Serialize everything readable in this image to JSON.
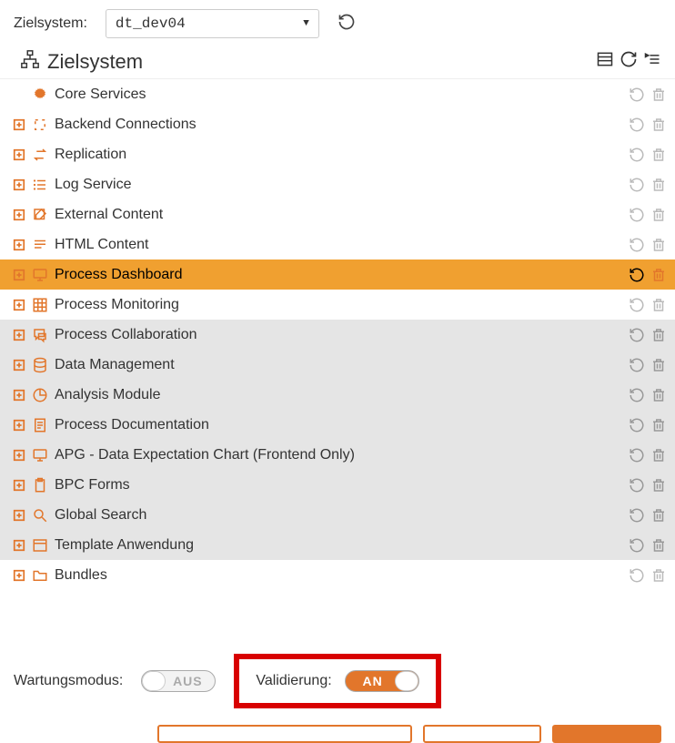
{
  "top": {
    "label": "Zielsystem:",
    "selected": "dt_dev04"
  },
  "section": {
    "title": "Zielsystem"
  },
  "tree": [
    {
      "label": "Core Services",
      "icon": "gear",
      "expand": false,
      "indent": true,
      "variant": "white",
      "selected": false
    },
    {
      "label": "Backend Connections",
      "icon": "brackets",
      "expand": true,
      "indent": false,
      "variant": "white",
      "selected": false
    },
    {
      "label": "Replication",
      "icon": "swap",
      "expand": true,
      "indent": false,
      "variant": "white",
      "selected": false
    },
    {
      "label": "Log Service",
      "icon": "list",
      "expand": true,
      "indent": false,
      "variant": "white",
      "selected": false
    },
    {
      "label": "External Content",
      "icon": "edit",
      "expand": true,
      "indent": false,
      "variant": "white",
      "selected": false
    },
    {
      "label": "HTML Content",
      "icon": "lines",
      "expand": true,
      "indent": false,
      "variant": "white",
      "selected": false
    },
    {
      "label": "Process Dashboard",
      "icon": "monitor",
      "expand": true,
      "indent": false,
      "variant": "sel",
      "selected": true
    },
    {
      "label": "Process Monitoring",
      "icon": "grid",
      "expand": true,
      "indent": false,
      "variant": "white",
      "selected": false
    },
    {
      "label": "Process Collaboration",
      "icon": "chat",
      "expand": true,
      "indent": false,
      "variant": "grey",
      "selected": false
    },
    {
      "label": "Data Management",
      "icon": "db",
      "expand": true,
      "indent": false,
      "variant": "grey",
      "selected": false
    },
    {
      "label": "Analysis Module",
      "icon": "pie",
      "expand": true,
      "indent": false,
      "variant": "grey",
      "selected": false
    },
    {
      "label": "Process Documentation",
      "icon": "doc",
      "expand": true,
      "indent": false,
      "variant": "grey",
      "selected": false
    },
    {
      "label": "APG - Data Expectation Chart (Frontend Only)",
      "icon": "monitor",
      "expand": true,
      "indent": false,
      "variant": "grey",
      "selected": false
    },
    {
      "label": "BPC Forms",
      "icon": "clip",
      "expand": true,
      "indent": false,
      "variant": "grey",
      "selected": false
    },
    {
      "label": "Global Search",
      "icon": "search",
      "expand": true,
      "indent": false,
      "variant": "grey",
      "selected": false
    },
    {
      "label": "Template Anwendung",
      "icon": "window",
      "expand": true,
      "indent": false,
      "variant": "grey",
      "selected": false
    },
    {
      "label": "Bundles",
      "icon": "folder",
      "expand": true,
      "indent": false,
      "variant": "white",
      "selected": false
    }
  ],
  "bottom": {
    "maint_label": "Wartungsmodus:",
    "maint_value": "AUS",
    "valid_label": "Validierung:",
    "valid_value": "AN"
  }
}
